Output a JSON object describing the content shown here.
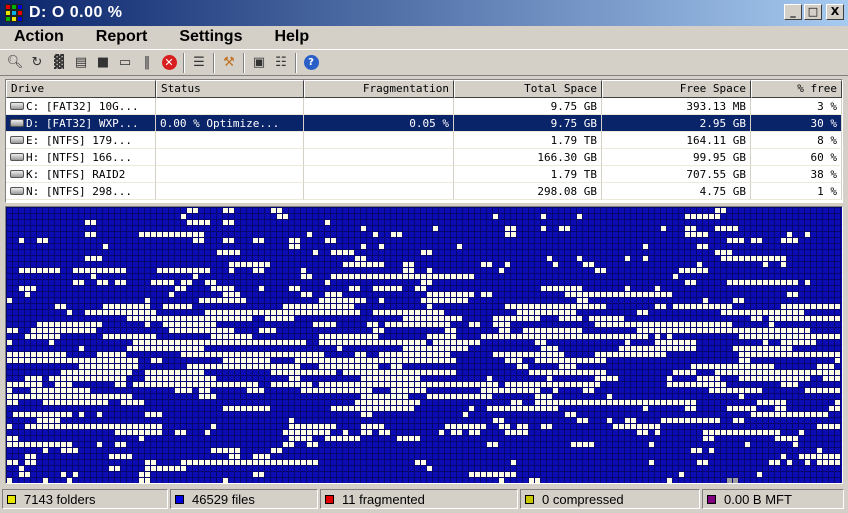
{
  "window": {
    "title": "D:  O  0.00 %",
    "minimize_label": "_",
    "maximize_label": "□",
    "close_label": "X"
  },
  "menu": {
    "items": [
      {
        "label": "Action"
      },
      {
        "label": "Report"
      },
      {
        "label": "Settings"
      },
      {
        "label": "Help"
      }
    ]
  },
  "toolbar": {
    "icons": [
      "analyze-icon",
      "repeat-icon",
      "defragment-icon",
      "quick-optimize-icon",
      "full-optimize-icon",
      "mft-optimize-icon",
      "pause-icon",
      "stop-icon",
      "report-icon",
      "settings-icon",
      "boot-time-icon",
      "script-icon",
      "help-icon"
    ]
  },
  "drive_list": {
    "columns": [
      "Drive",
      "Status",
      "Fragmentation",
      "Total Space",
      "Free Space",
      "% free"
    ],
    "rows": [
      {
        "drive": "C: [FAT32] 10G...",
        "status": "",
        "fragmentation": "",
        "total": "9.75 GB",
        "free": "393.13 MB",
        "pct": "3 %",
        "selected": false
      },
      {
        "drive": "D: [FAT32] WXP...",
        "status": "0.00 % Optimize...",
        "fragmentation": "0.05 %",
        "total": "9.75 GB",
        "free": "2.95 GB",
        "pct": "30 %",
        "selected": true
      },
      {
        "drive": "E: [NTFS]  179...",
        "status": "",
        "fragmentation": "",
        "total": "1.79 TB",
        "free": "164.11 GB",
        "pct": "8 %",
        "selected": false
      },
      {
        "drive": "H: [NTFS]  166...",
        "status": "",
        "fragmentation": "",
        "total": "166.30 GB",
        "free": "99.95 GB",
        "pct": "60 %",
        "selected": false
      },
      {
        "drive": "K: [NTFS]  RAID2",
        "status": "",
        "fragmentation": "",
        "total": "1.79 TB",
        "free": "707.55 GB",
        "pct": "38 %",
        "selected": false
      },
      {
        "drive": "N: [NTFS]  298...",
        "status": "",
        "fragmentation": "",
        "total": "298.08 GB",
        "free": "4.75 GB",
        "pct": "1 %",
        "selected": false
      }
    ]
  },
  "cluster_map": {
    "used_color": "#0c0cb4",
    "free_color": "#ffffe6",
    "mft_color": "#a0a0a0"
  },
  "status_bar": {
    "panels": [
      {
        "text": "7143 folders",
        "color": "#e6e600"
      },
      {
        "text": "46529 files",
        "color": "#0000e0"
      },
      {
        "text": "11 fragmented",
        "color": "#e00000"
      },
      {
        "text": "0 compressed",
        "color": "#c8c800"
      },
      {
        "text": "0.00 B MFT",
        "color": "#800080"
      }
    ]
  }
}
